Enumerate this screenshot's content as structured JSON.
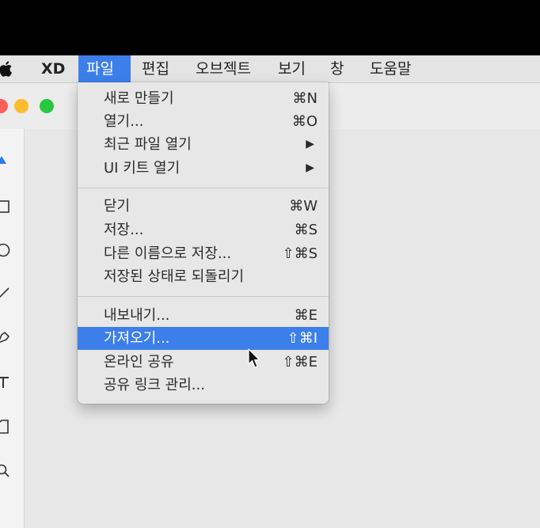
{
  "menubar": {
    "app_name": "XD",
    "items": [
      "파일",
      "편집",
      "오브젝트",
      "보기",
      "창",
      "도움말"
    ]
  },
  "file_menu": {
    "groups": [
      [
        {
          "label": "새로 만들기",
          "shortcut": "⌘N"
        },
        {
          "label": "열기...",
          "shortcut": "⌘O"
        },
        {
          "label": "최근 파일 열기",
          "shortcut": "▶"
        },
        {
          "label": "UI 키트 열기",
          "shortcut": "▶"
        }
      ],
      [
        {
          "label": "닫기",
          "shortcut": "⌘W"
        },
        {
          "label": "저장...",
          "shortcut": "⌘S"
        },
        {
          "label": "다른 이름으로 저장...",
          "shortcut": "⇧⌘S"
        },
        {
          "label": "저장된 상태로 되돌리기",
          "shortcut": ""
        }
      ],
      [
        {
          "label": "내보내기...",
          "shortcut": "⌘E"
        },
        {
          "label": "가져오기...",
          "shortcut": "⇧⌘I"
        },
        {
          "label": "온라인 공유",
          "shortcut": "⇧⌘E"
        },
        {
          "label": "공유 링크 관리...",
          "shortcut": ""
        }
      ]
    ]
  },
  "colors": {
    "highlight": "#3c7fea",
    "menu_bg": "#e7e7e7",
    "traffic_red": "#fc5f57",
    "traffic_yellow": "#fdbc2e",
    "traffic_green": "#28c940"
  },
  "icons": [
    "apple-icon",
    "close-window-icon",
    "minimize-window-icon",
    "zoom-window-icon",
    "select-tool-icon",
    "rectangle-tool-icon",
    "ellipse-tool-icon",
    "line-tool-icon",
    "pen-tool-icon",
    "text-tool-icon",
    "artboard-tool-icon",
    "zoom-tool-icon",
    "mouse-cursor-icon"
  ]
}
